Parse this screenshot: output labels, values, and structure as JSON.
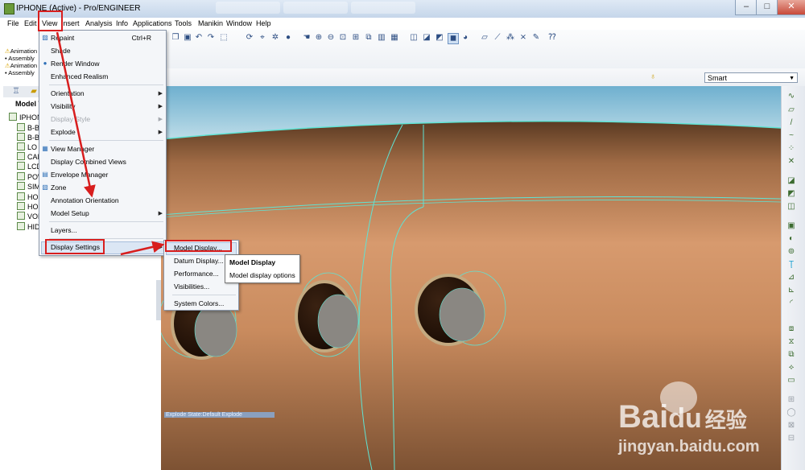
{
  "window": {
    "title": "IPHONE (Active) - Pro/ENGINEER",
    "controls": [
      "–",
      "□",
      "✕"
    ]
  },
  "menubar": [
    "File",
    "Edit",
    "View",
    "Insert",
    "Analysis",
    "Info",
    "Applications",
    "Tools",
    "Manikin",
    "Window",
    "Help"
  ],
  "selection_filter": {
    "value": "Smart"
  },
  "messages": [
    {
      "text": "Animation",
      "icon": "warning-icon"
    },
    {
      "text": "• Assembly",
      "icon": ""
    },
    {
      "text": "Animation",
      "icon": "warning-icon"
    },
    {
      "text": "• Assembly",
      "icon": ""
    }
  ],
  "model_tree": {
    "label": "Model T",
    "items": [
      "IPHONE",
      "B-BA",
      "B-BA",
      "LO",
      "CAM",
      "LCD",
      "POW",
      "SIM",
      "HOI",
      "HOI",
      "VOL",
      "HID"
    ]
  },
  "view_menu": {
    "items": [
      {
        "label": "Repaint",
        "shortcut": "Ctrl+R",
        "icon": "repaint-icon",
        "submenu": false,
        "disabled": false
      },
      {
        "label": "Shade",
        "shortcut": "",
        "icon": "",
        "submenu": false,
        "disabled": false
      },
      {
        "label": "Render Window",
        "shortcut": "",
        "icon": "render-icon",
        "submenu": false,
        "disabled": false
      },
      {
        "label": "Enhanced Realism",
        "shortcut": "",
        "icon": "",
        "submenu": false,
        "disabled": false
      },
      {
        "label": "Orientation",
        "shortcut": "",
        "icon": "",
        "submenu": true,
        "disabled": false
      },
      {
        "label": "Visibility",
        "shortcut": "",
        "icon": "",
        "submenu": true,
        "disabled": false
      },
      {
        "label": "Display Style",
        "shortcut": "",
        "icon": "",
        "submenu": true,
        "disabled": true
      },
      {
        "label": "Explode",
        "shortcut": "",
        "icon": "",
        "submenu": true,
        "disabled": false
      },
      {
        "label": "View Manager",
        "shortcut": "",
        "icon": "view-manager-icon",
        "submenu": false,
        "disabled": false
      },
      {
        "label": "Display Combined Views",
        "shortcut": "",
        "icon": "",
        "submenu": false,
        "disabled": false
      },
      {
        "label": "Envelope Manager",
        "shortcut": "",
        "icon": "envelope-icon",
        "submenu": false,
        "disabled": false
      },
      {
        "label": "Zone",
        "shortcut": "",
        "icon": "zone-icon",
        "submenu": false,
        "disabled": false
      },
      {
        "label": "Annotation Orientation",
        "shortcut": "",
        "icon": "",
        "submenu": false,
        "disabled": false
      },
      {
        "label": "Model Setup",
        "shortcut": "",
        "icon": "",
        "submenu": true,
        "disabled": false
      },
      {
        "label": "Layers...",
        "shortcut": "",
        "icon": "",
        "submenu": false,
        "disabled": false
      },
      {
        "label": "Display Settings",
        "shortcut": "",
        "icon": "",
        "submenu": true,
        "disabled": false
      }
    ]
  },
  "display_settings_menu": {
    "items": [
      "Model Display...",
      "Datum Display...",
      "Performance...",
      "Visibilities...",
      "System Colors..."
    ]
  },
  "tooltip": {
    "title": "Model Display",
    "description": "Model display options"
  },
  "status": {
    "explode_state": "Explode State:Default Explode"
  },
  "watermark": {
    "brand": "Bai",
    "brand2": "du",
    "chinese": "经验",
    "url": "jingyan.baidu.com"
  },
  "colors": {
    "accent_red": "#d81e1e",
    "edge_cyan": "#5fe3d4",
    "model_copper": "#c98b5e"
  }
}
